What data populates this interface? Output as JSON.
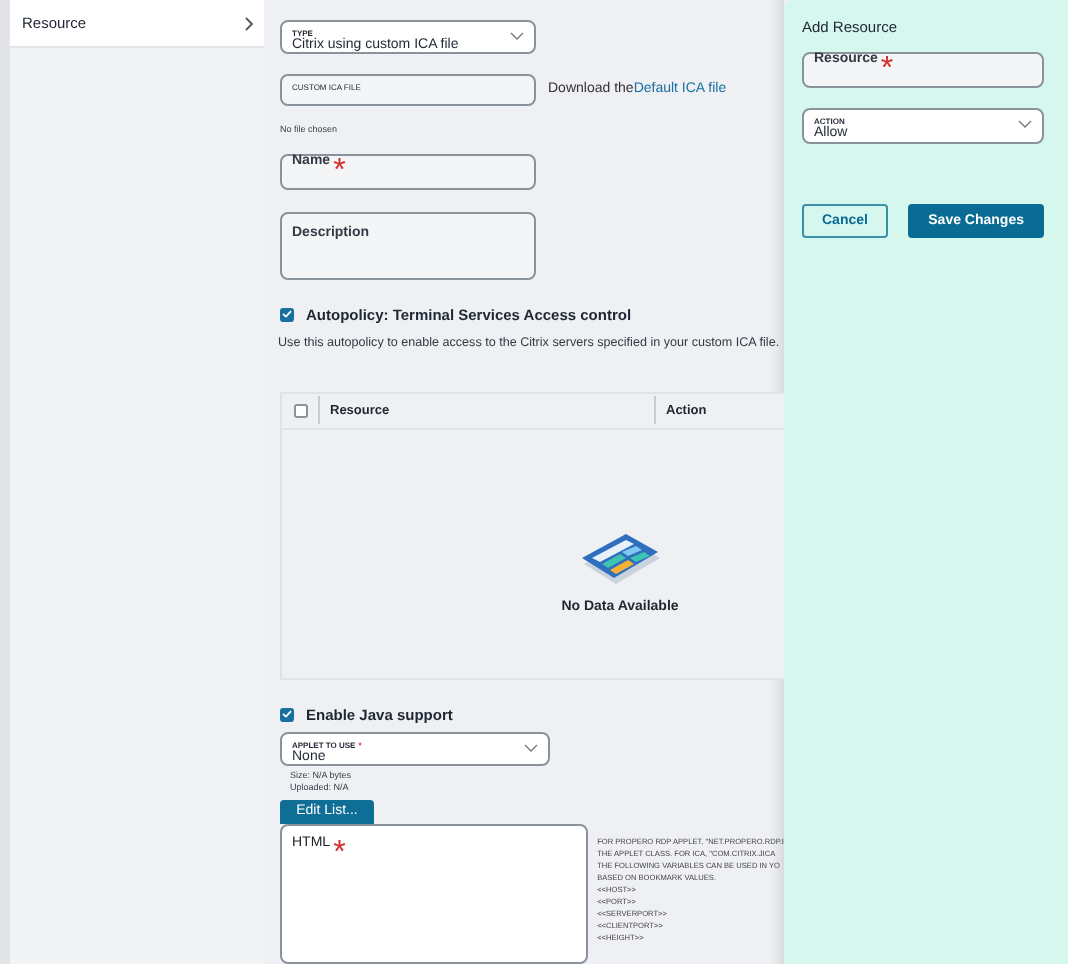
{
  "sidebar": {
    "items": [
      {
        "label": "Resource",
        "selected": true
      }
    ]
  },
  "form": {
    "type_select": {
      "label": "TYPE",
      "value": "Citrix using custom ICA file"
    },
    "file_field": {
      "label": "CUSTOM ICA FILE",
      "status": "No file chosen"
    },
    "download": {
      "text": "Download the",
      "link": "Default ICA file"
    },
    "name_field": {
      "placeholder": "Name",
      "required_mark": "*"
    },
    "description_field": {
      "placeholder": "Description"
    },
    "autopolicy": {
      "label": "Autopolicy: Terminal Services Access control",
      "checked": true,
      "description": "Use this autopolicy to enable access to the Citrix servers specified in your custom ICA file."
    },
    "table": {
      "select_all_checked": false,
      "columns": [
        "Resource",
        "Action"
      ],
      "empty_text": "No Data Available"
    },
    "java": {
      "label": "Enable Java support",
      "checked": true
    },
    "applet_select": {
      "label": "APPLET TO USE",
      "required_mark": "*",
      "value": "None"
    },
    "applet_info": [
      "Size: N/A bytes",
      "Uploaded: N/A"
    ],
    "edit_button": "Edit List...",
    "html_field": {
      "placeholder": "HTML",
      "required_mark": "*"
    },
    "help_lines": [
      "FOR PROPERO RDP APPLET, \"NET.PROPERO.RDP.I",
      "THE APPLET CLASS. FOR ICA, \"COM.CITRIX.JICA",
      "THE FOLLOWING VARIABLES CAN BE USED IN YO",
      "BASED ON BOOKMARK VALUES.",
      "<<HOST>>",
      "<<PORT>>",
      "<<SERVERPORT>>",
      "<<CLIENTPORT>>",
      "<<HEIGHT>>"
    ]
  },
  "panel": {
    "title": "Add Resource",
    "resource_field": {
      "placeholder": "Resource",
      "required_mark": "*"
    },
    "action_select": {
      "label": "ACTION",
      "value": "Allow"
    },
    "buttons": [
      {
        "label": "Cancel",
        "kind": "secondary"
      },
      {
        "label": "Save Changes",
        "kind": "primary"
      }
    ]
  }
}
